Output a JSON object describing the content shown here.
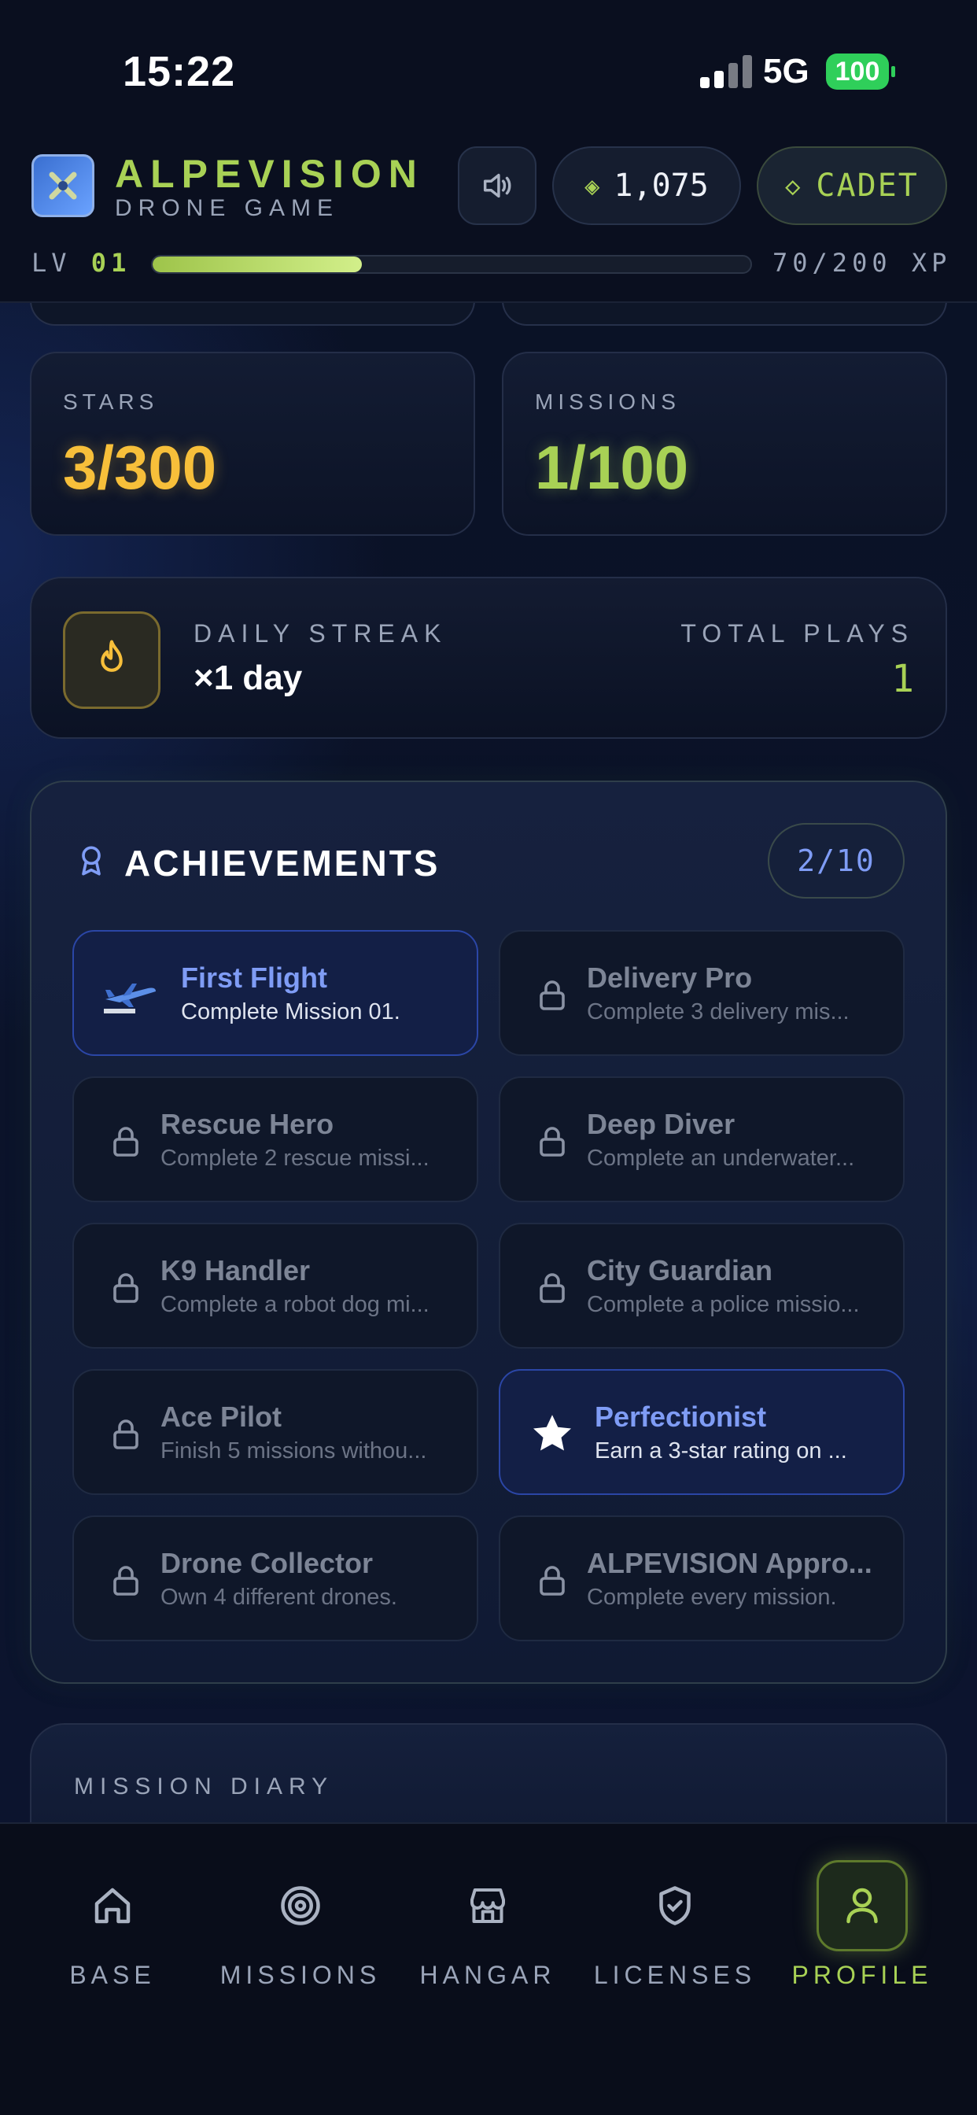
{
  "status_bar": {
    "time": "15:22",
    "network": "5G",
    "battery": "100"
  },
  "header": {
    "brand": "ALPEVISION",
    "subtitle": "DRONE GAME",
    "coins": "1,075",
    "rank": "CADET",
    "level_label": "LV",
    "level": "01",
    "xp_text": "70/200 XP",
    "xp_progress": 0.35
  },
  "stats": {
    "stars_label": "STARS",
    "stars_value": "3/300",
    "missions_label": "MISSIONS",
    "missions_value": "1/100"
  },
  "streak": {
    "label": "DAILY STREAK",
    "value": "×1 day",
    "plays_label": "TOTAL PLAYS",
    "plays_value": "1"
  },
  "achievements": {
    "title": "ACHIEVEMENTS",
    "count": "2/10",
    "items": [
      {
        "title": "First Flight",
        "desc": "Complete Mission 01.",
        "unlocked": true,
        "icon": "airplane-icon"
      },
      {
        "title": "Delivery Pro",
        "desc": "Complete 3 delivery mis...",
        "unlocked": false,
        "icon": "lock-icon"
      },
      {
        "title": "Rescue Hero",
        "desc": "Complete 2 rescue missi...",
        "unlocked": false,
        "icon": "lock-icon"
      },
      {
        "title": "Deep Diver",
        "desc": "Complete an underwater...",
        "unlocked": false,
        "icon": "lock-icon"
      },
      {
        "title": "K9 Handler",
        "desc": "Complete a robot dog mi...",
        "unlocked": false,
        "icon": "lock-icon"
      },
      {
        "title": "City Guardian",
        "desc": "Complete a police missio...",
        "unlocked": false,
        "icon": "lock-icon"
      },
      {
        "title": "Ace Pilot",
        "desc": "Finish 5 missions withou...",
        "unlocked": false,
        "icon": "lock-icon"
      },
      {
        "title": "Perfectionist",
        "desc": "Earn a 3-star rating on ...",
        "unlocked": true,
        "icon": "star-icon"
      },
      {
        "title": "Drone Collector",
        "desc": "Own 4 different drones.",
        "unlocked": false,
        "icon": "lock-icon"
      },
      {
        "title": "ALPEVISION Appro...",
        "desc": "Complete every mission.",
        "unlocked": false,
        "icon": "lock-icon"
      }
    ]
  },
  "diary": {
    "label": "MISSION DIARY"
  },
  "nav": [
    {
      "label": "BASE",
      "icon": "home-icon"
    },
    {
      "label": "MISSIONS",
      "icon": "target-icon"
    },
    {
      "label": "HANGAR",
      "icon": "store-icon"
    },
    {
      "label": "LICENSES",
      "icon": "shield-check-icon"
    },
    {
      "label": "PROFILE",
      "icon": "user-icon",
      "active": true
    }
  ],
  "colors": {
    "accent_green": "#a8d155",
    "star_gold": "#f7bf3a",
    "unlocked_blue": "#7f9cf5",
    "background": "#0a1124"
  }
}
